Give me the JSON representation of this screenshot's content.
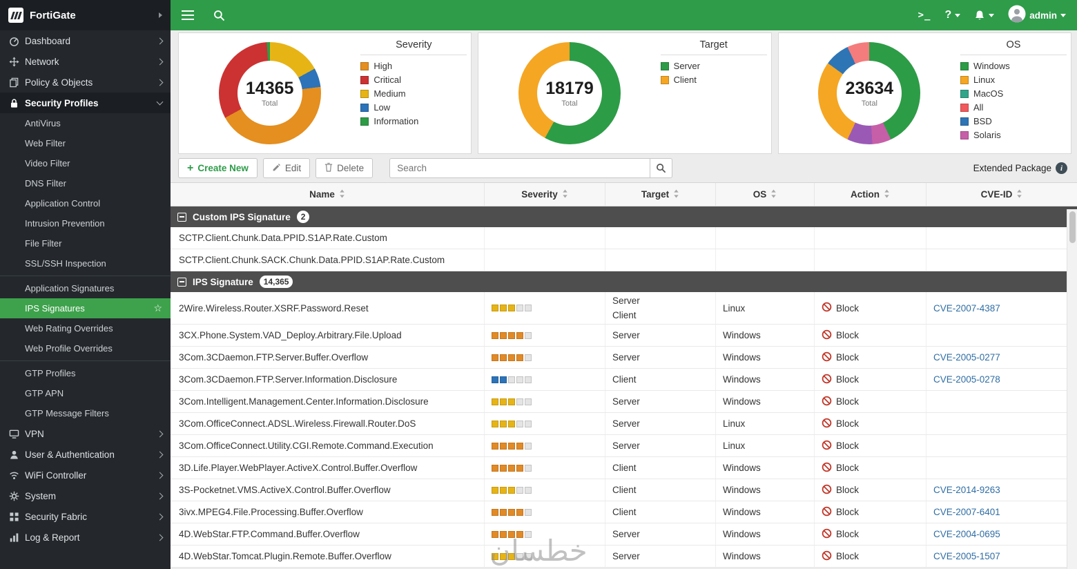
{
  "topbar": {
    "admin_label": "admin"
  },
  "watermark": "خطسان",
  "sidebar": {
    "brand": "FortiGate",
    "items": [
      {
        "id": "dashboard",
        "label": "Dashboard",
        "icon": "dashboard",
        "chevron": "right"
      },
      {
        "id": "network",
        "label": "Network",
        "icon": "network",
        "chevron": "right"
      },
      {
        "id": "policy-objects",
        "label": "Policy & Objects",
        "icon": "policy",
        "chevron": "right"
      },
      {
        "id": "security-profiles",
        "label": "Security Profiles",
        "icon": "lock",
        "chevron": "down",
        "active_section": true,
        "children": [
          {
            "label": "AntiVirus"
          },
          {
            "label": "Web Filter"
          },
          {
            "label": "Video Filter"
          },
          {
            "label": "DNS Filter"
          },
          {
            "label": "Application Control"
          },
          {
            "label": "Intrusion Prevention"
          },
          {
            "label": "File Filter"
          },
          {
            "label": "SSL/SSH Inspection",
            "divider_after": true
          },
          {
            "label": "Application Signatures"
          },
          {
            "label": "IPS Signatures",
            "selected": true,
            "star": true
          },
          {
            "label": "Web Rating Overrides"
          },
          {
            "label": "Web Profile Overrides",
            "divider_after": true
          },
          {
            "label": "GTP Profiles"
          },
          {
            "label": "GTP APN"
          },
          {
            "label": "GTP Message Filters"
          }
        ]
      },
      {
        "id": "vpn",
        "label": "VPN",
        "icon": "vpn",
        "chevron": "right"
      },
      {
        "id": "user-authentication",
        "label": "User & Authentication",
        "icon": "user",
        "chevron": "right"
      },
      {
        "id": "wifi-controller",
        "label": "WiFi Controller",
        "icon": "wifi",
        "chevron": "right"
      },
      {
        "id": "system",
        "label": "System",
        "icon": "gear",
        "chevron": "right"
      },
      {
        "id": "security-fabric",
        "label": "Security Fabric",
        "icon": "fabric",
        "chevron": "right"
      },
      {
        "id": "log-report",
        "label": "Log & Report",
        "icon": "chart",
        "chevron": "right"
      }
    ]
  },
  "charts": [
    {
      "id": "severity",
      "type": "donut",
      "title": "Severity",
      "total": "14365",
      "total_label": "Total",
      "segments": [
        {
          "label": "Medium",
          "color": "#E7B416",
          "pct": 17
        },
        {
          "label": "Low",
          "color": "#2C73B9",
          "pct": 6
        },
        {
          "label": "High",
          "color": "#E48F1F",
          "pct": 44
        },
        {
          "label": "Critical",
          "color": "#CC3232",
          "pct": 32
        },
        {
          "label": "Information",
          "color": "#2D9C46",
          "pct": 1
        }
      ],
      "legend": [
        {
          "label": "High",
          "color": "#E48F1F"
        },
        {
          "label": "Critical",
          "color": "#CC3232"
        },
        {
          "label": "Medium",
          "color": "#E7B416"
        },
        {
          "label": "Low",
          "color": "#2C73B9"
        },
        {
          "label": "Information",
          "color": "#2D9C46"
        }
      ]
    },
    {
      "id": "target",
      "type": "donut",
      "title": "Target",
      "total": "18179",
      "total_label": "Total",
      "segments": [
        {
          "label": "Server",
          "color": "#2D9C46",
          "pct": 58
        },
        {
          "label": "Client",
          "color": "#F5A623",
          "pct": 42
        }
      ],
      "legend": [
        {
          "label": "Server",
          "color": "#2D9C46"
        },
        {
          "label": "Client",
          "color": "#F5A623"
        }
      ]
    },
    {
      "id": "os",
      "type": "donut",
      "title": "OS",
      "total": "23634",
      "total_label": "Total",
      "segments": [
        {
          "label": "Windows",
          "color": "#2D9C46",
          "pct": 43
        },
        {
          "label": "Solaris",
          "color": "#C75FA8",
          "pct": 6
        },
        {
          "label": "MacOS",
          "color": "#9B59B6",
          "pct": 8
        },
        {
          "label": "Linux",
          "color": "#F5A623",
          "pct": 28
        },
        {
          "label": "BSD",
          "color": "#2E75B6",
          "pct": 8
        },
        {
          "label": "All",
          "color": "#F47C7C",
          "pct": 7
        }
      ],
      "legend": [
        {
          "label": "Windows",
          "color": "#2D9C46"
        },
        {
          "label": "Linux",
          "color": "#F5A623"
        },
        {
          "label": "MacOS",
          "color": "#31A58A"
        },
        {
          "label": "All",
          "color": "#F1595C"
        },
        {
          "label": "BSD",
          "color": "#2E75B6"
        },
        {
          "label": "Solaris",
          "color": "#C75FA8"
        }
      ]
    }
  ],
  "toolbar": {
    "create_label": "Create New",
    "edit_label": "Edit",
    "delete_label": "Delete",
    "search_placeholder": "Search",
    "package_label": "Extended Package"
  },
  "table": {
    "columns": [
      {
        "label": "Name"
      },
      {
        "label": "Severity"
      },
      {
        "label": "Target"
      },
      {
        "label": "OS"
      },
      {
        "label": "Action"
      },
      {
        "label": "CVE-ID"
      }
    ],
    "sections": [
      {
        "title": "Custom IPS Signature",
        "count": "2",
        "rows": [
          {
            "name": "SCTP.Client.Chunk.Data.PPID.S1AP.Rate.Custom"
          },
          {
            "name": "SCTP.Client.Chunk.SACK.Chunk.Data.PPID.S1AP.Rate.Custom"
          }
        ]
      },
      {
        "title": "IPS Signature",
        "count": "14,365",
        "rows": [
          {
            "name": "2Wire.Wireless.Router.XSRF.Password.Reset",
            "severity": 3,
            "sev_color": "#E7B416",
            "target": [
              "Server",
              "Client"
            ],
            "os": "Linux",
            "action": "Block",
            "cve": "CVE-2007-4387"
          },
          {
            "name": "3CX.Phone.System.VAD_Deploy.Arbitrary.File.Upload",
            "severity": 4,
            "sev_color": "#E28A26",
            "target": [
              "Server"
            ],
            "os": "Windows",
            "action": "Block",
            "cve": ""
          },
          {
            "name": "3Com.3CDaemon.FTP.Server.Buffer.Overflow",
            "severity": 4,
            "sev_color": "#E28A26",
            "target": [
              "Server"
            ],
            "os": "Windows",
            "action": "Block",
            "cve": "CVE-2005-0277"
          },
          {
            "name": "3Com.3CDaemon.FTP.Server.Information.Disclosure",
            "severity": 2,
            "sev_color": "#2C73B9",
            "target": [
              "Client"
            ],
            "os": "Windows",
            "action": "Block",
            "cve": "CVE-2005-0278"
          },
          {
            "name": "3Com.Intelligent.Management.Center.Information.Disclosure",
            "severity": 3,
            "sev_color": "#E7B416",
            "target": [
              "Server"
            ],
            "os": "Windows",
            "action": "Block",
            "cve": ""
          },
          {
            "name": "3Com.OfficeConnect.ADSL.Wireless.Firewall.Router.DoS",
            "severity": 3,
            "sev_color": "#E7B416",
            "target": [
              "Server"
            ],
            "os": "Linux",
            "action": "Block",
            "cve": ""
          },
          {
            "name": "3Com.OfficeConnect.Utility.CGI.Remote.Command.Execution",
            "severity": 4,
            "sev_color": "#E28A26",
            "target": [
              "Server"
            ],
            "os": "Linux",
            "action": "Block",
            "cve": ""
          },
          {
            "name": "3D.Life.Player.WebPlayer.ActiveX.Control.Buffer.Overflow",
            "severity": 4,
            "sev_color": "#E28A26",
            "target": [
              "Client"
            ],
            "os": "Windows",
            "action": "Block",
            "cve": ""
          },
          {
            "name": "3S-Pocketnet.VMS.ActiveX.Control.Buffer.Overflow",
            "severity": 3,
            "sev_color": "#E7B416",
            "target": [
              "Client"
            ],
            "os": "Windows",
            "action": "Block",
            "cve": "CVE-2014-9263"
          },
          {
            "name": "3ivx.MPEG4.File.Processing.Buffer.Overflow",
            "severity": 4,
            "sev_color": "#E28A26",
            "target": [
              "Client"
            ],
            "os": "Windows",
            "action": "Block",
            "cve": "CVE-2007-6401"
          },
          {
            "name": "4D.WebStar.FTP.Command.Buffer.Overflow",
            "severity": 4,
            "sev_color": "#E28A26",
            "target": [
              "Server"
            ],
            "os": "Windows",
            "action": "Block",
            "cve": "CVE-2004-0695"
          },
          {
            "name": "4D.WebStar.Tomcat.Plugin.Remote.Buffer.Overflow",
            "severity": 3,
            "sev_color": "#E7B416",
            "target": [
              "Server"
            ],
            "os": "Windows",
            "action": "Block",
            "cve": "CVE-2005-1507"
          }
        ]
      }
    ]
  }
}
